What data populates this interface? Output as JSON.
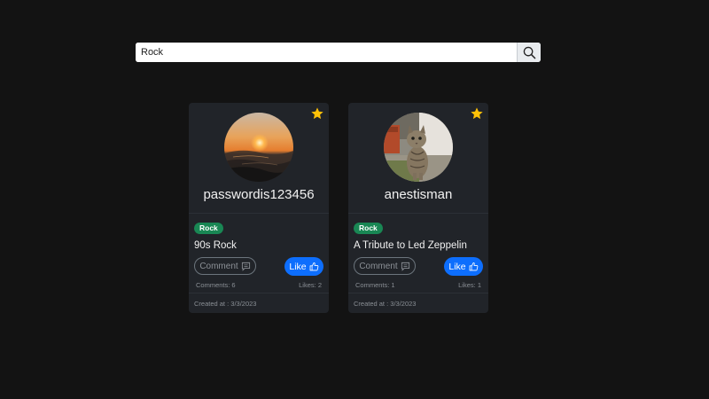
{
  "search": {
    "value": "Rock",
    "icon": "search-icon"
  },
  "posts": [
    {
      "username": "passwordis123456",
      "avatar": "sunset-ocean-photo",
      "genre": "Rock",
      "title": "90s Rock",
      "comment_label": "Comment",
      "like_label": "Like",
      "comments": "Comments: 6",
      "likes": "Likes: 2",
      "created": "Created at : 3/3/2023",
      "favorite_icon": "star-icon"
    },
    {
      "username": "anestisman",
      "avatar": "cat-photo",
      "genre": "Rock",
      "title": "A Tribute to Led Zeppelin",
      "comment_label": "Comment",
      "like_label": "Like",
      "comments": "Comments: 1",
      "likes": "Likes: 1",
      "created": "Created at : 3/3/2023",
      "favorite_icon": "star-icon"
    }
  ],
  "colors": {
    "background": "#131313",
    "card": "#212429",
    "badge": "#198754",
    "like": "#0d6efd",
    "star": "#ffc107"
  }
}
